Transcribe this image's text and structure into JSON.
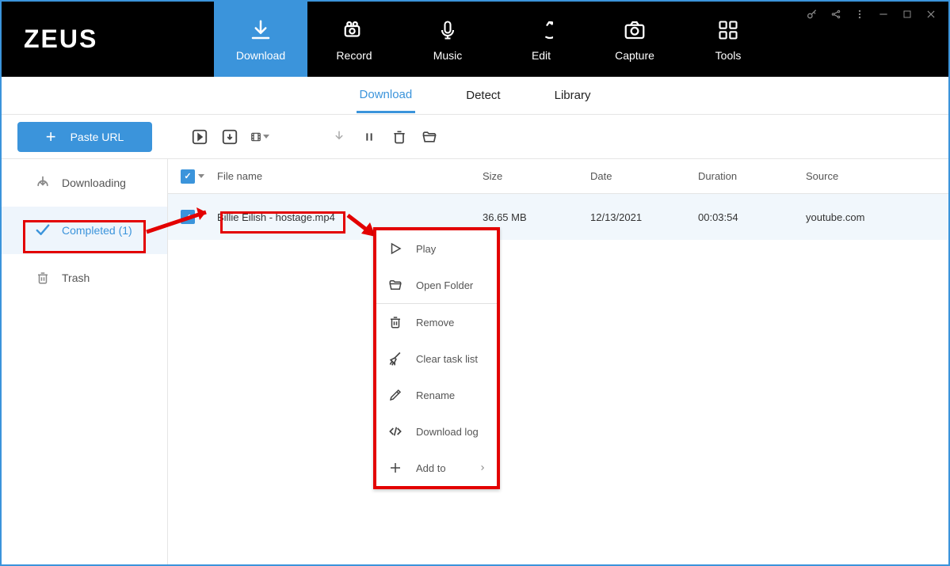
{
  "app": {
    "name": "ZEUS"
  },
  "top_tabs": [
    {
      "label": "Download"
    },
    {
      "label": "Record"
    },
    {
      "label": "Music"
    },
    {
      "label": "Edit"
    },
    {
      "label": "Capture"
    },
    {
      "label": "Tools"
    }
  ],
  "sub_tabs": [
    {
      "label": "Download"
    },
    {
      "label": "Detect"
    },
    {
      "label": "Library"
    }
  ],
  "paste_btn": "Paste URL",
  "sidebar": [
    {
      "label": "Downloading"
    },
    {
      "label": "Completed (1)"
    },
    {
      "label": "Trash"
    }
  ],
  "columns": {
    "file": "File name",
    "size": "Size",
    "date": "Date",
    "dur": "Duration",
    "src": "Source"
  },
  "rows": [
    {
      "name": "Billie Eilish - hostage.mp4",
      "size": "36.65 MB",
      "date": "12/13/2021",
      "dur": "00:03:54",
      "src": "youtube.com"
    }
  ],
  "context_menu": [
    {
      "label": "Play"
    },
    {
      "label": "Open Folder"
    },
    {
      "label": "Remove"
    },
    {
      "label": "Clear task list"
    },
    {
      "label": "Rename"
    },
    {
      "label": "Download log"
    },
    {
      "label": "Add to",
      "submenu": true
    }
  ]
}
